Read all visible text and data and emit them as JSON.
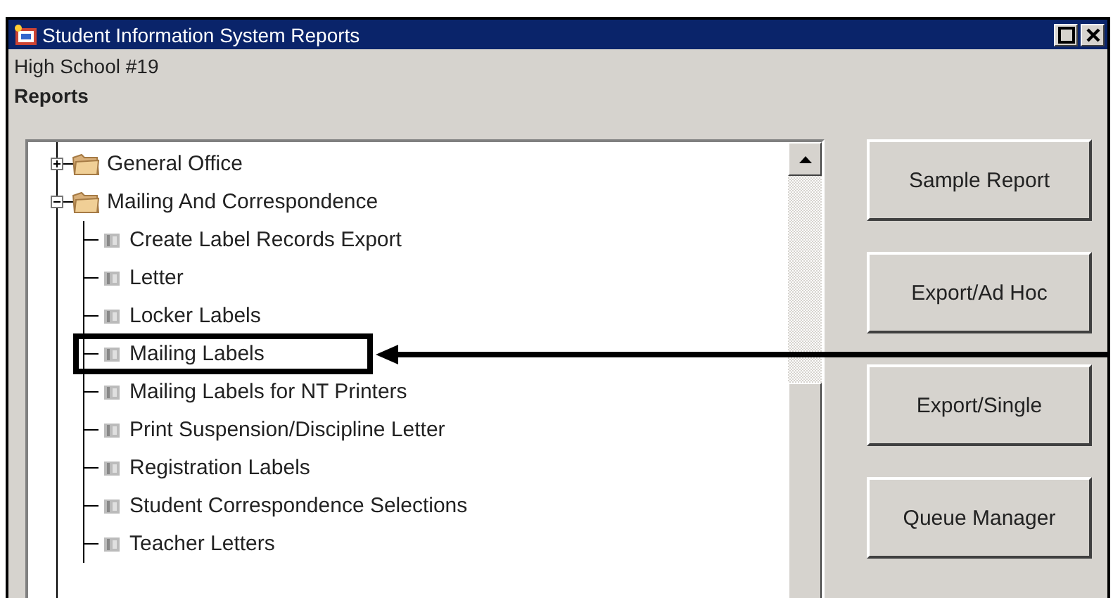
{
  "window": {
    "title": "Student Information System Reports"
  },
  "school": "High School #19",
  "section_title": "Reports",
  "tree": [
    {
      "label": "General Office",
      "expanded": false
    },
    {
      "label": "Mailing And Correspondence",
      "expanded": true,
      "children": [
        {
          "label": "Create Label Records Export",
          "highlighted": false
        },
        {
          "label": "Letter",
          "highlighted": false
        },
        {
          "label": "Locker Labels",
          "highlighted": false
        },
        {
          "label": "Mailing Labels",
          "highlighted": true
        },
        {
          "label": "Mailing Labels for NT Printers",
          "highlighted": false
        },
        {
          "label": "Print Suspension/Discipline Letter",
          "highlighted": false
        },
        {
          "label": "Registration Labels",
          "highlighted": false
        },
        {
          "label": "Student Correspondence Selections",
          "highlighted": false
        },
        {
          "label": "Teacher Letters",
          "highlighted": false
        }
      ]
    }
  ],
  "buttons": [
    "Sample Report",
    "Export/Ad Hoc",
    "Export/Single",
    "Queue Manager"
  ]
}
